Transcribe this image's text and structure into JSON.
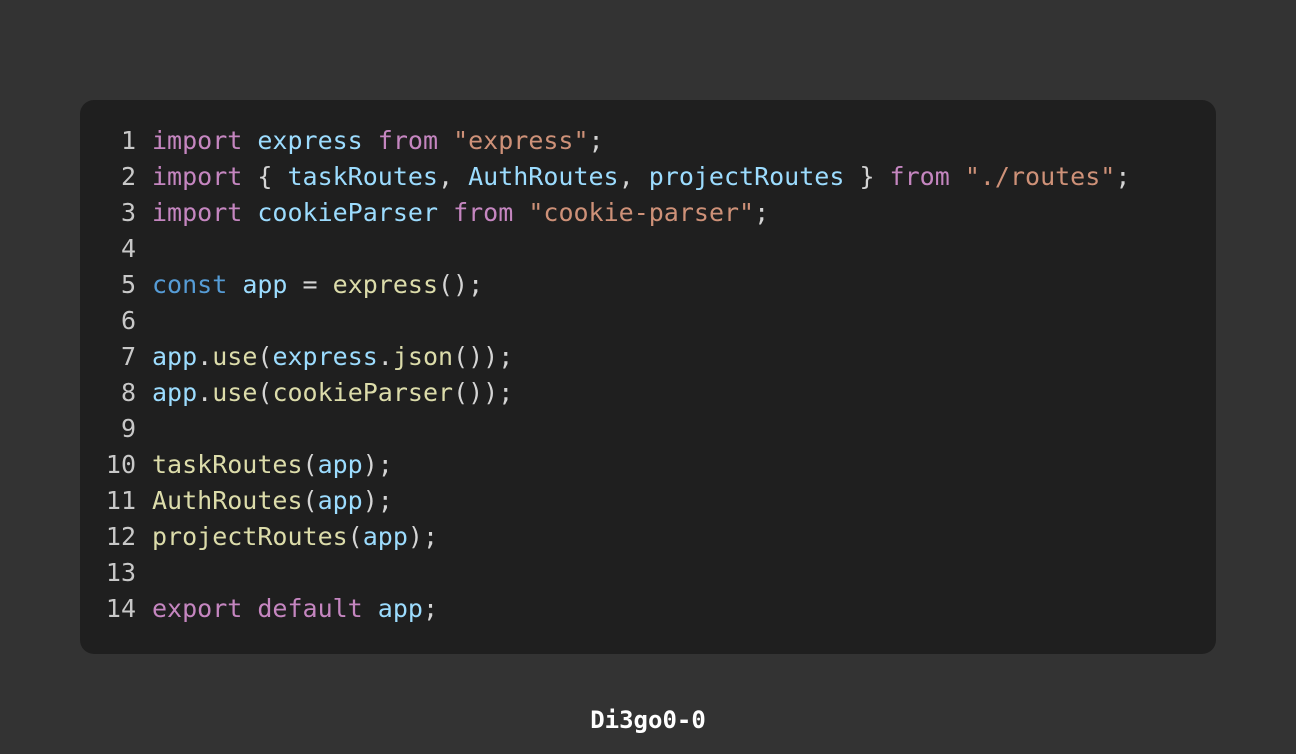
{
  "theme": {
    "background": "#333333",
    "panel": "#1f1f1f",
    "line_number": "#c8c8c8",
    "plain": "#d4d4d4",
    "keyword_control": "#c586c0",
    "keyword_storage": "#569cd6",
    "string": "#ce9178",
    "variable": "#9cdcfe",
    "function": "#dcdcaa"
  },
  "code": {
    "language": "javascript",
    "lines": [
      {
        "n": "1",
        "tokens": [
          {
            "t": "import",
            "c": "keyword_control"
          },
          {
            "t": " ",
            "c": "plain"
          },
          {
            "t": "express",
            "c": "variable"
          },
          {
            "t": " ",
            "c": "plain"
          },
          {
            "t": "from",
            "c": "keyword_control"
          },
          {
            "t": " ",
            "c": "plain"
          },
          {
            "t": "\"express\"",
            "c": "string"
          },
          {
            "t": ";",
            "c": "plain"
          }
        ]
      },
      {
        "n": "2",
        "tokens": [
          {
            "t": "import",
            "c": "keyword_control"
          },
          {
            "t": " { ",
            "c": "plain"
          },
          {
            "t": "taskRoutes",
            "c": "variable"
          },
          {
            "t": ", ",
            "c": "plain"
          },
          {
            "t": "AuthRoutes",
            "c": "variable"
          },
          {
            "t": ", ",
            "c": "plain"
          },
          {
            "t": "projectRoutes",
            "c": "variable"
          },
          {
            "t": " } ",
            "c": "plain"
          },
          {
            "t": "from",
            "c": "keyword_control"
          },
          {
            "t": " ",
            "c": "plain"
          },
          {
            "t": "\"./routes\"",
            "c": "string"
          },
          {
            "t": ";",
            "c": "plain"
          }
        ]
      },
      {
        "n": "3",
        "tokens": [
          {
            "t": "import",
            "c": "keyword_control"
          },
          {
            "t": " ",
            "c": "plain"
          },
          {
            "t": "cookieParser",
            "c": "variable"
          },
          {
            "t": " ",
            "c": "plain"
          },
          {
            "t": "from",
            "c": "keyword_control"
          },
          {
            "t": " ",
            "c": "plain"
          },
          {
            "t": "\"cookie-parser\"",
            "c": "string"
          },
          {
            "t": ";",
            "c": "plain"
          }
        ]
      },
      {
        "n": "4",
        "tokens": []
      },
      {
        "n": "5",
        "tokens": [
          {
            "t": "const",
            "c": "keyword_storage"
          },
          {
            "t": " ",
            "c": "plain"
          },
          {
            "t": "app",
            "c": "variable"
          },
          {
            "t": " = ",
            "c": "plain"
          },
          {
            "t": "express",
            "c": "function"
          },
          {
            "t": "();",
            "c": "plain"
          }
        ]
      },
      {
        "n": "6",
        "tokens": []
      },
      {
        "n": "7",
        "tokens": [
          {
            "t": "app",
            "c": "variable"
          },
          {
            "t": ".",
            "c": "plain"
          },
          {
            "t": "use",
            "c": "function"
          },
          {
            "t": "(",
            "c": "plain"
          },
          {
            "t": "express",
            "c": "variable"
          },
          {
            "t": ".",
            "c": "plain"
          },
          {
            "t": "json",
            "c": "function"
          },
          {
            "t": "());",
            "c": "plain"
          }
        ]
      },
      {
        "n": "8",
        "tokens": [
          {
            "t": "app",
            "c": "variable"
          },
          {
            "t": ".",
            "c": "plain"
          },
          {
            "t": "use",
            "c": "function"
          },
          {
            "t": "(",
            "c": "plain"
          },
          {
            "t": "cookieParser",
            "c": "function"
          },
          {
            "t": "());",
            "c": "plain"
          }
        ]
      },
      {
        "n": "9",
        "tokens": []
      },
      {
        "n": "10",
        "tokens": [
          {
            "t": "taskRoutes",
            "c": "function"
          },
          {
            "t": "(",
            "c": "plain"
          },
          {
            "t": "app",
            "c": "variable"
          },
          {
            "t": ");",
            "c": "plain"
          }
        ]
      },
      {
        "n": "11",
        "tokens": [
          {
            "t": "AuthRoutes",
            "c": "function"
          },
          {
            "t": "(",
            "c": "plain"
          },
          {
            "t": "app",
            "c": "variable"
          },
          {
            "t": ");",
            "c": "plain"
          }
        ]
      },
      {
        "n": "12",
        "tokens": [
          {
            "t": "projectRoutes",
            "c": "function"
          },
          {
            "t": "(",
            "c": "plain"
          },
          {
            "t": "app",
            "c": "variable"
          },
          {
            "t": ");",
            "c": "plain"
          }
        ]
      },
      {
        "n": "13",
        "tokens": []
      },
      {
        "n": "14",
        "tokens": [
          {
            "t": "export",
            "c": "keyword_control"
          },
          {
            "t": " ",
            "c": "plain"
          },
          {
            "t": "default",
            "c": "keyword_control"
          },
          {
            "t": " ",
            "c": "plain"
          },
          {
            "t": "app",
            "c": "variable"
          },
          {
            "t": ";",
            "c": "plain"
          }
        ]
      }
    ]
  },
  "footer": {
    "author": "Di3go0-0"
  }
}
